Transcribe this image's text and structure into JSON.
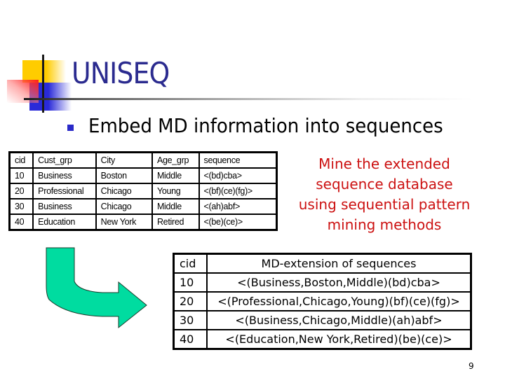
{
  "slide": {
    "title": "UNISEQ",
    "bullet": "Embed MD information into sequences",
    "page_number": "9"
  },
  "md_table": {
    "headers": [
      "cid",
      "Cust_grp",
      "City",
      "Age_grp",
      "sequence"
    ],
    "rows": [
      [
        "10",
        "Business",
        "Boston",
        "Middle",
        "<(bd)cba>"
      ],
      [
        "20",
        "Professional",
        "Chicago",
        "Young",
        "<(bf)(ce)(fg)>"
      ],
      [
        "30",
        "Business",
        "Chicago",
        "Middle",
        "<(ah)abf>"
      ],
      [
        "40",
        "Education",
        "New York",
        "Retired",
        "<(be)(ce)>"
      ]
    ]
  },
  "side_note": {
    "lines": [
      "Mine the extended",
      "sequence database",
      "using sequential pattern",
      "mining methods"
    ],
    "color": "#cc1111"
  },
  "ext_table": {
    "headers": [
      "cid",
      "MD-extension of sequences"
    ],
    "rows": [
      [
        "10",
        "<(Business,Boston,Middle)(bd)cba>"
      ],
      [
        "20",
        "<(Professional,Chicago,Young)(bf)(ce)(fg)>"
      ],
      [
        "30",
        "<(Business,Chicago,Middle)(ah)abf>"
      ],
      [
        "40",
        "<(Education,New York,Retired)(be)(ce)>"
      ]
    ]
  },
  "colors": {
    "title": "#2b2b8f",
    "arrow_fill": "#00dca0",
    "bullet": "#2a2ac8"
  },
  "icons": {
    "arrow": "curved-arrow-down-right",
    "bullet": "square-bullet"
  }
}
